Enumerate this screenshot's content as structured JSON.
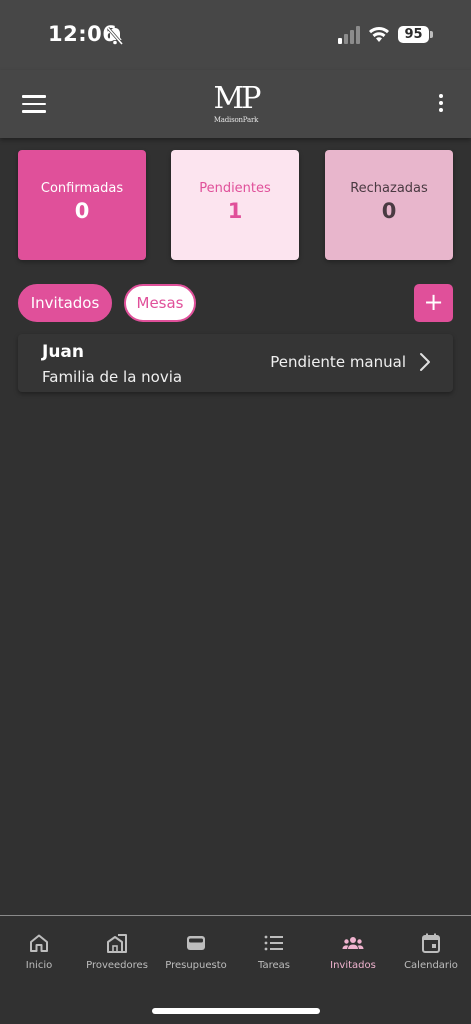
{
  "status_bar": {
    "time": "12:06",
    "battery": "95"
  },
  "app_bar": {
    "logo_mark": "MP",
    "logo_text": "MadisonPark"
  },
  "stats": [
    {
      "label": "Confirmadas",
      "value": "0"
    },
    {
      "label": "Pendientes",
      "value": "1"
    },
    {
      "label": "Rechazadas",
      "value": "0"
    }
  ],
  "tabs": {
    "invitados": "Invitados",
    "mesas": "Mesas"
  },
  "add_button": "+",
  "guests": [
    {
      "name": "Juan",
      "group": "Familia de la novia",
      "status": "Pendiente manual"
    }
  ],
  "bottom_nav": [
    {
      "label": "Inicio",
      "icon": "home-icon"
    },
    {
      "label": "Proveedores",
      "icon": "store-icon"
    },
    {
      "label": "Presupuesto",
      "icon": "wallet-icon"
    },
    {
      "label": "Tareas",
      "icon": "list-icon"
    },
    {
      "label": "Invitados",
      "icon": "people-icon",
      "active": true
    },
    {
      "label": "Calendario",
      "icon": "calendar-icon"
    }
  ],
  "colors": {
    "accent": "#e0509a",
    "background": "#313131",
    "appbar": "#474747"
  }
}
